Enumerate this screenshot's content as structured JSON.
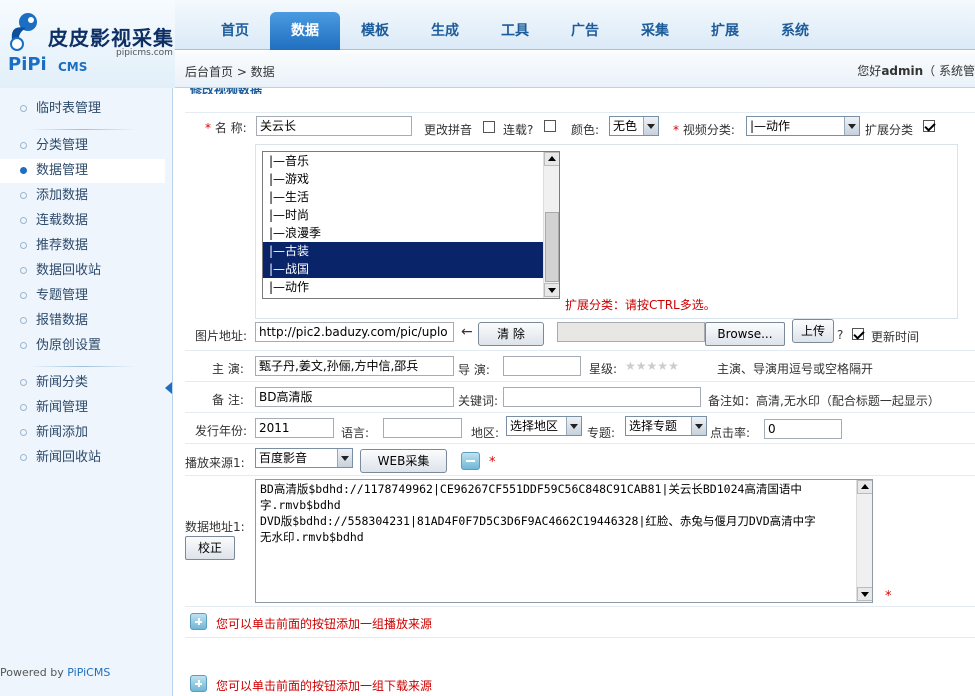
{
  "logo": {
    "title": "皮皮影视采集",
    "site": "pipicms.com",
    "brand_pipi": "PiPi",
    "brand_cms": "CMS"
  },
  "nav": {
    "items": [
      "首页",
      "数据",
      "模板",
      "生成",
      "工具",
      "广告",
      "采集",
      "扩展",
      "系统"
    ],
    "active": "数据"
  },
  "crumb": "后台首页 > 数据",
  "greeting": {
    "prefix": "您好",
    "user": "admin",
    "suffix": "（ 系统管"
  },
  "sidebar": {
    "items": [
      "临时表管理",
      "分类管理",
      "数据管理",
      "添加数据",
      "连载数据",
      "推荐数据",
      "数据回收站",
      "专题管理",
      "报错数据",
      "伪原创设置",
      "新闻分类",
      "新闻管理",
      "新闻添加",
      "新闻回收站"
    ],
    "active": "数据管理"
  },
  "powered": {
    "prefix": "Powered by ",
    "brand": "PiPiCMS"
  },
  "section_title": "修改视频数据",
  "form": {
    "name_label": "名 称:",
    "name_value": "关云长",
    "pinyin_label": "更改拼音",
    "serial_label": "连载?",
    "color_label": "颜色:",
    "color_value": "无色",
    "category_label": "视频分类:",
    "category_value": "|—动作",
    "ext_label": "扩展分类",
    "ext_list": [
      "|—音乐",
      "|—游戏",
      "|—生活",
      "|—时尚",
      "|—浪漫季",
      "|—古装",
      "|—战国",
      "|—动作"
    ],
    "ext_selected": [
      "|—古装",
      "|—战国"
    ],
    "ext_hint": "扩展分类：请按CTRL多选。",
    "pic_label": "图片地址:",
    "pic_value": "http://pic2.baduzy.com/pic/uplo",
    "pic_arrow": "←",
    "clear_button": "清 除",
    "browse_button": "Browse...",
    "upload_button": "上传",
    "question": "?",
    "update_time_label": "更新时间",
    "actor_label": "主 演:",
    "actor_value": "甄子丹,姜文,孙俪,方中信,邵兵",
    "director_label": "导 演:",
    "director_value": "",
    "star_label": "星级:",
    "star_count": 5,
    "actor_hint": "主演、导演用逗号或空格隔开",
    "note_label": "备 注:",
    "note_value": "BD高清版",
    "keyword_label": "关键词:",
    "keyword_value": "",
    "note_hint": "备注如：高清,无水印（配合标题一起显示）",
    "year_label": "发行年份:",
    "year_value": "2011",
    "lang_label": "语言:",
    "lang_value": "",
    "area_label": "地区:",
    "area_value": "选择地区",
    "topic_label": "专题:",
    "topic_value": "选择专题",
    "hits_label": "点击率:",
    "hits_value": "0",
    "source_label": "播放来源1:",
    "source_value": "百度影音",
    "web_button": "WEB采集",
    "data_label": "数据地址1:",
    "fix_button": "校正",
    "data_lines": [
      "BD高清版$bdhd://1178749962|CE96267CF551DDF59C56C848C91CAB81|关云长BD1024高清国语中",
      "字.rmvb$bdhd",
      "DVD版$bdhd://558304231|81AD4F0F7D5C3D6F9AC4662C19446328|红脸、赤兔与偃月刀DVD高清中字",
      "无水印.rmvb$bdhd"
    ],
    "add_play_hint": "您可以单击前面的按钮添加一组播放来源",
    "add_down_hint": "您可以单击前面的按钮添加一组下载来源",
    "required_mark": "*"
  },
  "colors": {
    "accent": "#1f6fc0",
    "selected": "#0a246a",
    "required": "#dd0000"
  }
}
